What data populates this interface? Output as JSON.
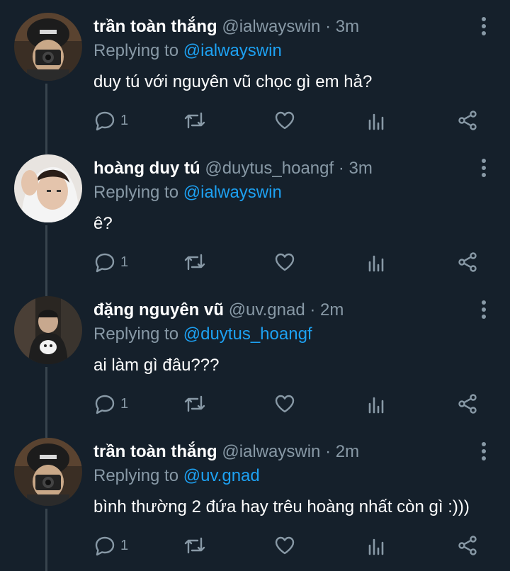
{
  "colors": {
    "background": "#15202b",
    "text_primary": "#ffffff",
    "text_secondary": "#8899a6",
    "accent": "#1da1f2",
    "thread_line": "#38444d"
  },
  "icons": {
    "reply": "reply-icon",
    "retweet": "retweet-icon",
    "like": "heart-icon",
    "analytics": "analytics-icon",
    "share": "share-icon",
    "more": "more-vertical-icon"
  },
  "tweets": [
    {
      "name": "trần toàn thắng",
      "handle": "@ialwayswin",
      "dot": "·",
      "time": "3m",
      "replying_prefix": "Replying to",
      "replying_to": "@ialwayswin",
      "text": "duy tú với nguyên vũ chọc gì em hả?",
      "reply_count": "1"
    },
    {
      "name": "hoàng duy tú",
      "handle": "@duytus_hoangf",
      "dot": "·",
      "time": "3m",
      "replying_prefix": "Replying to",
      "replying_to": "@ialwayswin",
      "text": "ê?",
      "reply_count": "1"
    },
    {
      "name": "đặng nguyên vũ",
      "handle": "@uv.gnad",
      "dot": "·",
      "time": "2m",
      "replying_prefix": "Replying to",
      "replying_to": "@duytus_hoangf",
      "text": "ai làm gì đâu???",
      "reply_count": "1"
    },
    {
      "name": "trần toàn thắng",
      "handle": "@ialwayswin",
      "dot": "·",
      "time": "2m",
      "replying_prefix": "Replying to",
      "replying_to": "@uv.gnad",
      "text": "bình thường 2 đứa hay trêu hoàng nhất còn gì :)))",
      "reply_count": "1"
    }
  ]
}
